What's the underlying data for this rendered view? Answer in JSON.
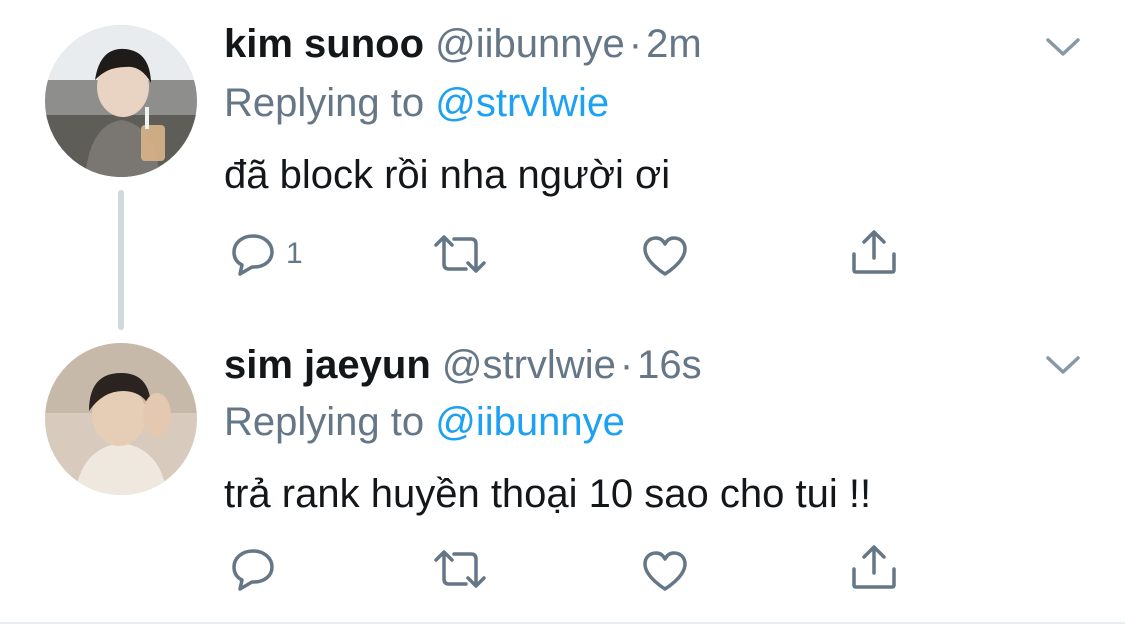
{
  "tweets": [
    {
      "name": "kim sunoo",
      "handle": "@iibunnye",
      "separator": "·",
      "time": "2m",
      "replying_prefix": "Replying to ",
      "replying_to": "@strvlwie",
      "text": "đã block rồi nha người ơi",
      "reply_count": "1"
    },
    {
      "name": "sim jaeyun",
      "handle": "@strvlwie",
      "separator": "·",
      "time": "16s",
      "replying_prefix": "Replying to ",
      "replying_to": "@iibunnye",
      "text": "trả rank huyền thoại 10 sao cho tui !!",
      "reply_count": ""
    }
  ],
  "colors": {
    "text": "#14171a",
    "secondary": "#657786",
    "accent": "#1da1f2",
    "thread_line": "#cfd9de"
  },
  "icons": [
    "reply-icon",
    "retweet-icon",
    "like-icon",
    "share-icon",
    "chevron-down-icon"
  ]
}
